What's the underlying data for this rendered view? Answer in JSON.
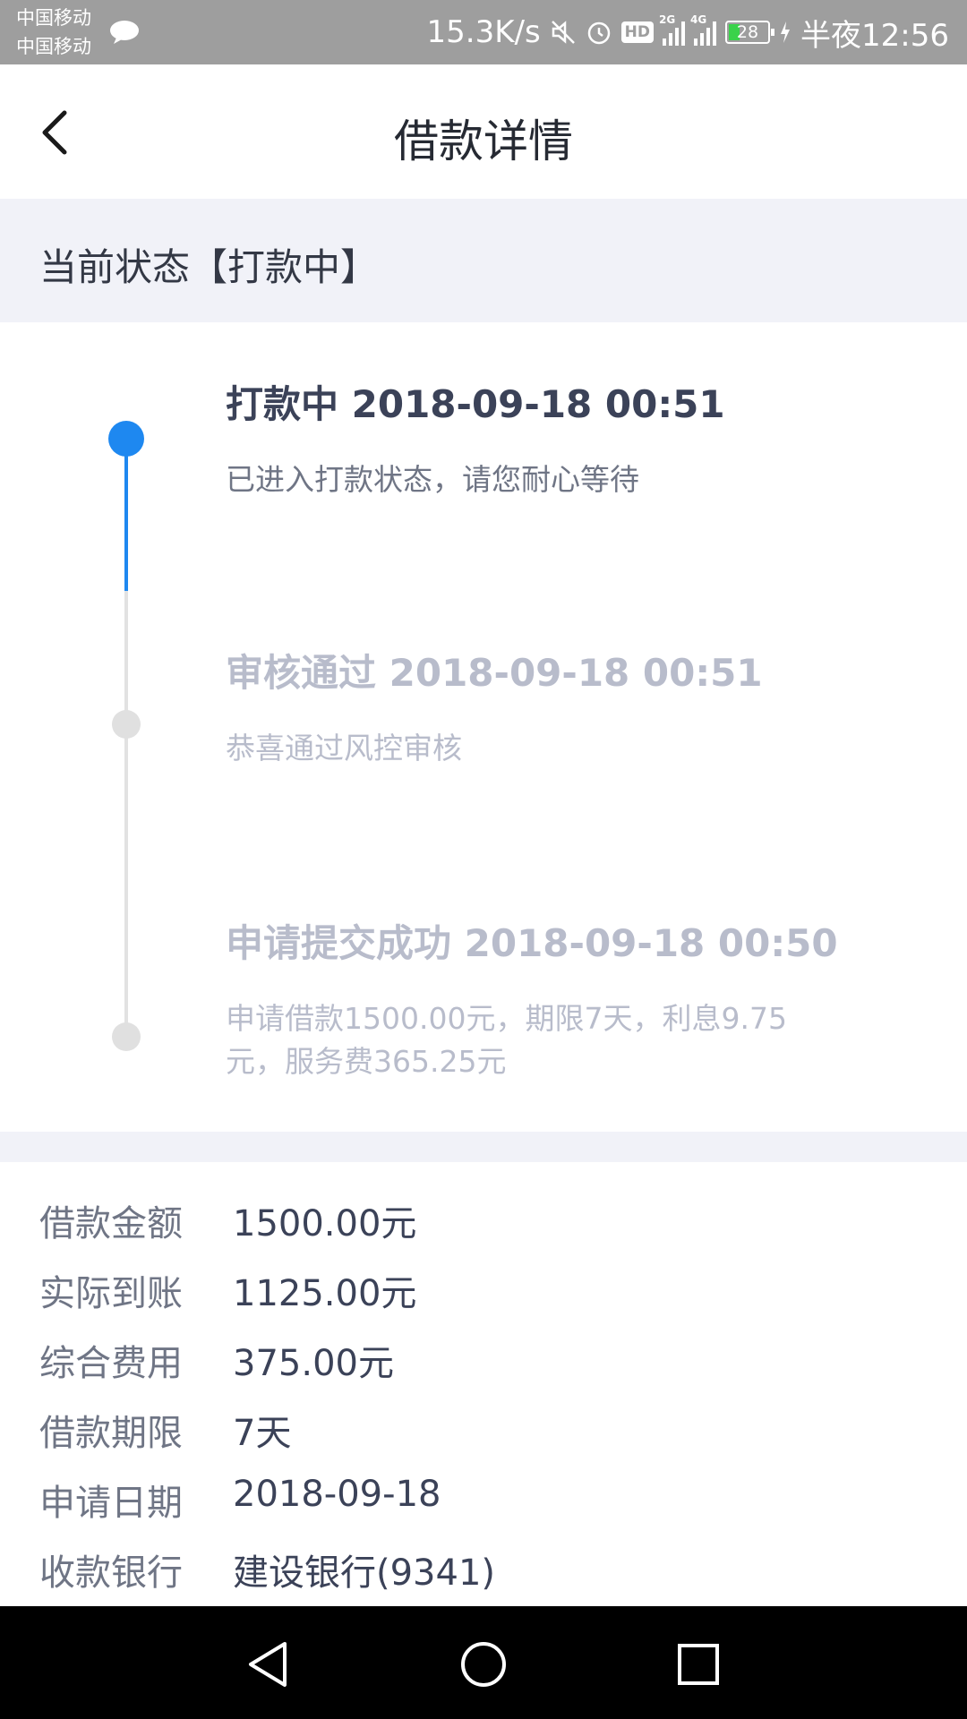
{
  "status_bar": {
    "carrier_1": "中国移动",
    "carrier_2": "中国移动",
    "speed": "15.3K/s",
    "hd": "HD",
    "net_2g": "2G",
    "net_4g": "4G",
    "battery": "28",
    "time": "半夜12:56"
  },
  "header": {
    "title": "借款详情"
  },
  "status_band": {
    "text": "当前状态【打款中】"
  },
  "timeline": [
    {
      "title": "打款中 2018-09-18 00:51",
      "desc": "已进入打款状态，请您耐心等待"
    },
    {
      "title": "审核通过 2018-09-18 00:51",
      "desc": "恭喜通过风控审核"
    },
    {
      "title": "申请提交成功 2018-09-18 00:50",
      "desc": "申请借款1500.00元，期限7天，利息9.75元，服务费365.25元"
    }
  ],
  "details": [
    {
      "label": "借款金额",
      "value": "1500.00元"
    },
    {
      "label": "实际到账",
      "value": "1125.00元"
    },
    {
      "label": "综合费用",
      "value": "375.00元"
    },
    {
      "label": "借款期限",
      "value": "7天"
    },
    {
      "label": "申请日期",
      "value": "2018-09-18"
    },
    {
      "label": "收款银行",
      "value": "建设银行(9341)"
    }
  ],
  "colors": {
    "accent": "#1e88f0",
    "band": "#f1f2f8",
    "muted": "#b8bccb"
  }
}
